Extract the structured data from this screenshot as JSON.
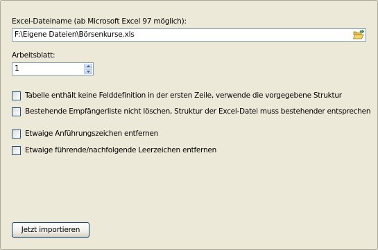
{
  "excel": {
    "filename_label": "Excel-Dateiname (ab Microsoft Excel 97 möglich):",
    "filename_value": "F:\\Eigene Dateien\\Börsenkurse.xls",
    "sheet_label": "Arbeitsblatt:",
    "sheet_value": "1"
  },
  "options": [
    {
      "label": "Tabelle enthält keine Felddefinition in der ersten Zeile, verwende die vorgegebene Struktur",
      "checked": false
    },
    {
      "label": "Bestehende Empfängerliste nicht löschen, Struktur der Excel-Datei muss bestehender entsprechen",
      "checked": false
    },
    {
      "label": "Etwaige Anführungszeichen entfernen",
      "checked": false
    },
    {
      "label": "Etwaige führende/nachfolgende Leerzeichen entfernen",
      "checked": false
    }
  ],
  "actions": {
    "import_label": "Jetzt importieren"
  },
  "icons": {
    "browse": "folder-open-icon",
    "spin_up": "arrow-up-icon",
    "spin_down": "arrow-down-icon"
  },
  "colors": {
    "background": "#ece9d8",
    "input_border": "#7f9db9",
    "checkbox_border": "#1c5180",
    "button_border": "#003c74"
  }
}
